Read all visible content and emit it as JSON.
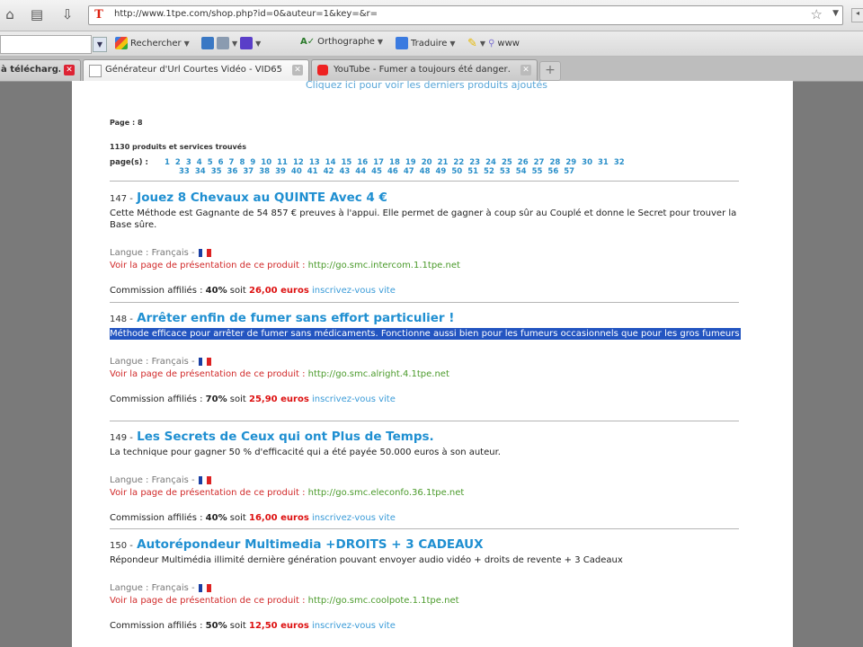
{
  "browser": {
    "url": "http://www.1tpe.com/shop.php?id=0&auteur=1&key=&r=",
    "toolbar": {
      "search_label": "Rechercher",
      "spell_label": "Orthographe",
      "translate_label": "Traduire",
      "extra_label": "www"
    },
    "tabs": [
      {
        "title": "à télécharg…",
        "active": false
      },
      {
        "title": "Générateur d'Url Courtes Vidéo - VID65…",
        "active": true
      },
      {
        "title": "YouTube - Fumer a toujours été danger…",
        "active": false
      }
    ]
  },
  "page": {
    "top_link": "Cliquez ici pour voir les derniers produits ajoutés",
    "page_label": "Page : 8",
    "count_label": "1130 produits et services trouvés",
    "pages_label": "page(s) :",
    "page_numbers": [
      "1",
      "2",
      "3",
      "4",
      "5",
      "6",
      "7",
      "8",
      "9",
      "10",
      "11",
      "12",
      "13",
      "14",
      "15",
      "16",
      "17",
      "18",
      "19",
      "20",
      "21",
      "22",
      "23",
      "24",
      "25",
      "26",
      "27",
      "28",
      "29",
      "30",
      "31",
      "32",
      "33",
      "34",
      "35",
      "36",
      "37",
      "38",
      "39",
      "40",
      "41",
      "42",
      "43",
      "44",
      "45",
      "46",
      "47",
      "48",
      "49",
      "50",
      "51",
      "52",
      "53",
      "54",
      "55",
      "56",
      "57"
    ],
    "products": [
      {
        "num": "147 -",
        "title": "Jouez 8 Chevaux au QUINTE Avec 4 €",
        "desc": "Cette Méthode est Gagnante de 54 857 € preuves à l'appui. Elle permet de gagner à coup sûr au Couplé et donne le Secret pour trouver la Base sûre.",
        "selected": false,
        "lang_label": "Langue : Français -",
        "link_label": "Voir la page de présentation de ce produit :",
        "link_url": "http://go.smc.intercom.1.1tpe.net",
        "comm_label": "Commission affiliés :",
        "comm_pct": "40%",
        "comm_soit": "soit",
        "comm_amount": "26,00 euros",
        "register": "inscrivez-vous vite"
      },
      {
        "num": "148 -",
        "title": "Arrêter enfin de fumer sans effort particulier !",
        "desc": "Méthode efficace pour arrêter de fumer sans médicaments. Fonctionne aussi bien pour les fumeurs occasionnels que pour les gros fumeurs",
        "selected": true,
        "lang_label": "Langue : Français -",
        "link_label": "Voir la page de présentation de ce produit :",
        "link_url": "http://go.smc.alright.4.1tpe.net",
        "comm_label": "Commission affiliés :",
        "comm_pct": "70%",
        "comm_soit": "soit",
        "comm_amount": "25,90 euros",
        "register": "inscrivez-vous vite"
      },
      {
        "num": "149 -",
        "title": "Les Secrets de Ceux qui ont Plus de Temps.",
        "desc": "La technique pour gagner 50 % d'efficacité qui a été payée 50.000 euros à son auteur.",
        "selected": false,
        "lang_label": "Langue : Français -",
        "link_label": "Voir la page de présentation de ce produit :",
        "link_url": "http://go.smc.eleconfo.36.1tpe.net",
        "comm_label": "Commission affiliés :",
        "comm_pct": "40%",
        "comm_soit": "soit",
        "comm_amount": "16,00 euros",
        "register": "inscrivez-vous vite"
      },
      {
        "num": "150 -",
        "title": "Autorépondeur Multimedia +DROITS + 3 CADEAUX",
        "desc": "Répondeur Multimédia illimité dernière génération pouvant envoyer audio vidéo + droits de revente + 3 Cadeaux",
        "selected": false,
        "lang_label": "Langue : Français -",
        "link_label": "Voir la page de présentation de ce produit :",
        "link_url": "http://go.smc.coolpote.1.1tpe.net",
        "comm_label": "Commission affiliés :",
        "comm_pct": "50%",
        "comm_soit": "soit",
        "comm_amount": "12,50 euros",
        "register": "inscrivez-vous vite"
      }
    ]
  },
  "colors": {
    "title_blue": "#1f8fd1",
    "link_red": "#d12a2a",
    "url_green": "#4a9a2a",
    "selection": "#2355c1"
  }
}
